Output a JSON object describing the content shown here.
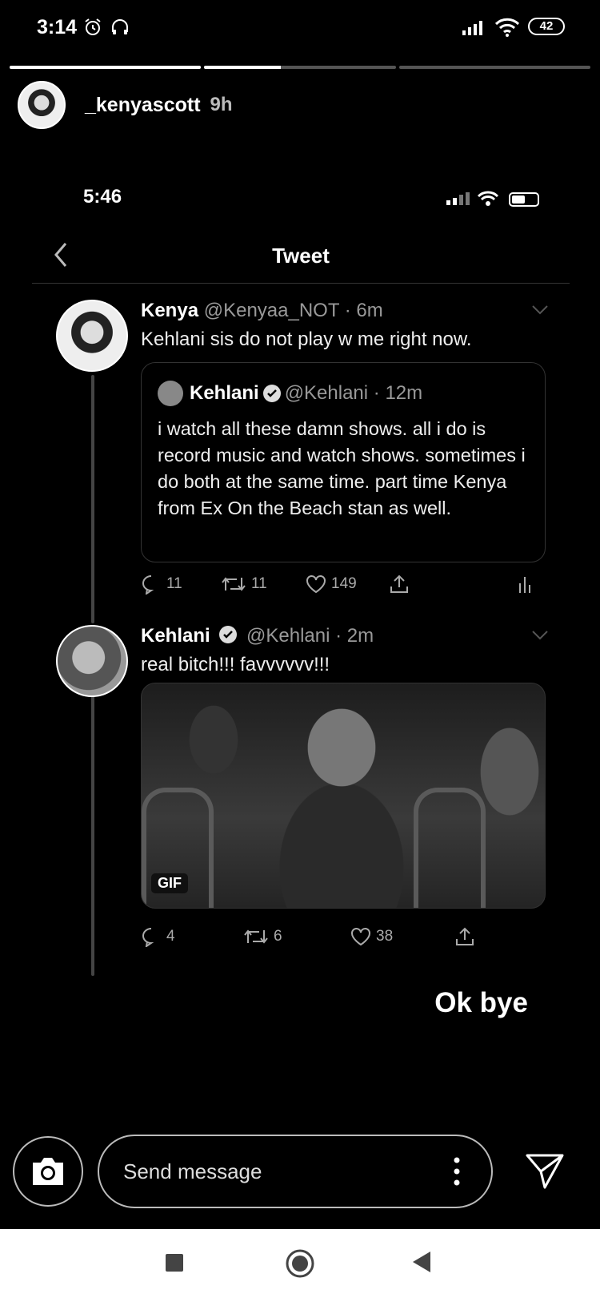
{
  "status_bar": {
    "time": "3:14",
    "battery": "42"
  },
  "story": {
    "progress": [
      1.0,
      0.4,
      0.0
    ],
    "username": "_kenyascott",
    "posted_ago": "9h"
  },
  "screenshot": {
    "status_time": "5:46",
    "header_title": "Tweet",
    "tweet1": {
      "name": "Kenya",
      "handle_time": "@Kenyaa_NOT · 6m",
      "text": "Kehlani sis do not play w me right now.",
      "quote": {
        "name": "Kehlani",
        "handle_time": "@Kehlani · 12m",
        "text": "i watch all these damn shows. all i do is record music and watch shows. sometimes i do both at the same time. part time Kenya from Ex On the Beach stan as well."
      },
      "replies": "11",
      "retweets": "11",
      "likes": "149"
    },
    "tweet2": {
      "name": "Kehlani",
      "handle_time": "@Kehlani · 2m",
      "text": "real bitch!!! favvvvvv!!!",
      "gif_badge": "GIF",
      "replies": "4",
      "retweets": "6",
      "likes": "38"
    }
  },
  "caption": "Ok bye",
  "compose": {
    "placeholder": "Send message"
  },
  "icons": {
    "alarm": "alarm-icon",
    "headset": "headset-icon",
    "signal": "signal-icon",
    "wifi": "wifi-icon",
    "back": "back-chevron-icon",
    "camera": "camera-icon",
    "send": "send-icon",
    "more": "more-vertical-icon"
  }
}
